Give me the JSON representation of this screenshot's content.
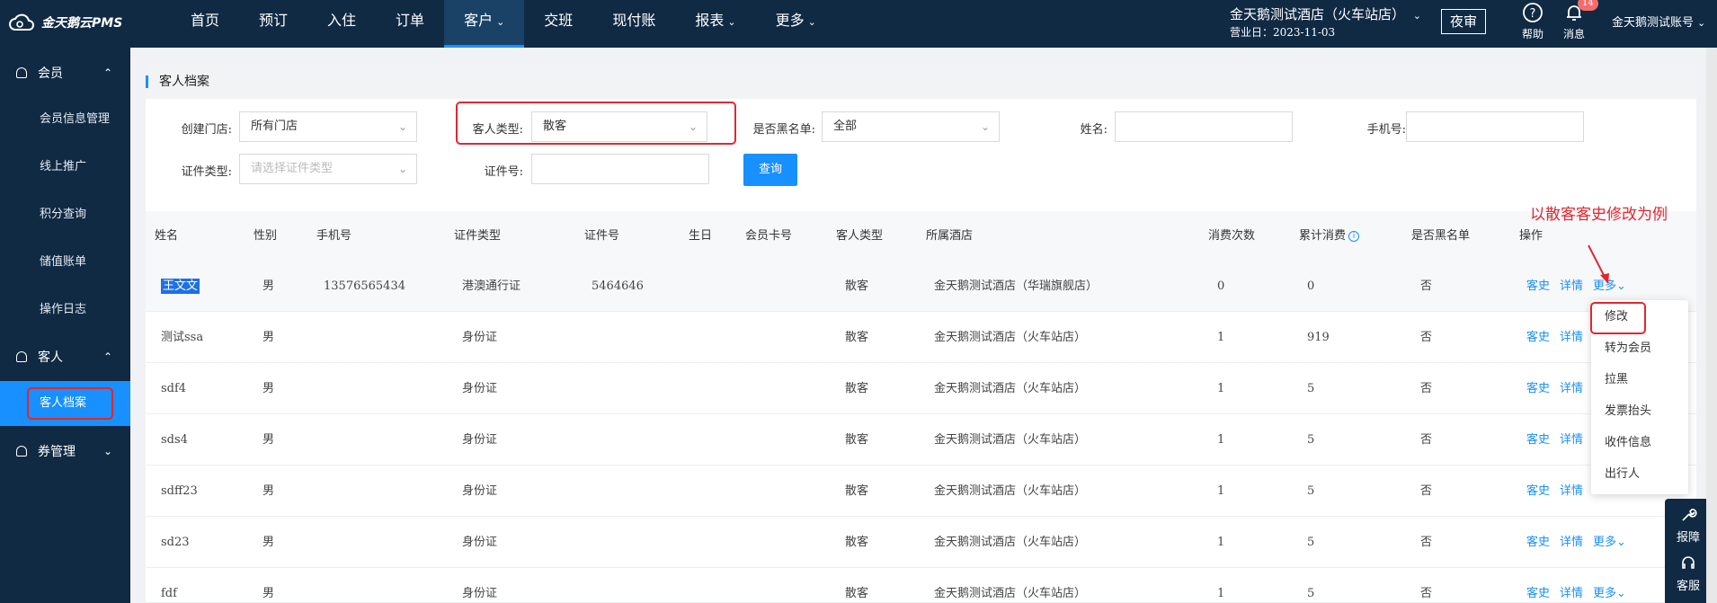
{
  "app": {
    "logo_text": "金天鹅云PMS"
  },
  "nav": [
    {
      "label": "首页"
    },
    {
      "label": "预订"
    },
    {
      "label": "入住"
    },
    {
      "label": "订单"
    },
    {
      "label": "客户"
    },
    {
      "label": "交班"
    },
    {
      "label": "现付账"
    },
    {
      "label": "报表"
    },
    {
      "label": "更多"
    }
  ],
  "topbar": {
    "hotel_name": "金天鹅测试酒店（火车站店）",
    "business_date": "营业日：2023-11-03",
    "night_audit": "夜审",
    "help": "帮助",
    "messages": "消息",
    "message_badge": "14",
    "account": "金天鹅测试账号"
  },
  "sidebar": {
    "groups": [
      {
        "label": "会员",
        "items": [
          "会员信息管理",
          "线上推广",
          "积分查询",
          "储值账单",
          "操作日志"
        ]
      },
      {
        "label": "客人",
        "items": [
          "客人档案"
        ]
      },
      {
        "label": "券管理",
        "items": []
      }
    ]
  },
  "page": {
    "title": "客人档案"
  },
  "filters": {
    "store_label": "创建门店:",
    "store_value": "所有门店",
    "guest_type_label": "客人类型:",
    "guest_type_value": "散客",
    "blacklist_label": "是否黑名单:",
    "blacklist_value": "全部",
    "name_label": "姓名:",
    "phone_label": "手机号:",
    "id_type_label": "证件类型:",
    "id_type_placeholder": "请选择证件类型",
    "id_no_label": "证件号:",
    "query_button": "查询"
  },
  "table": {
    "columns": [
      "姓名",
      "性别",
      "手机号",
      "证件类型",
      "证件号",
      "生日",
      "会员卡号",
      "客人类型",
      "所属酒店",
      "消费次数",
      "累计消费",
      "是否黑名单",
      "操作"
    ],
    "rows": [
      {
        "name": "王文文",
        "gender": "男",
        "phone": "13576565434",
        "id_type": "港澳通行证",
        "id_no": "5464646",
        "birthday": "",
        "card": "",
        "guest_type": "散客",
        "hotel": "金天鹅测试酒店（华瑞旗舰店）",
        "visits": "0",
        "total": "0",
        "blacklist": "否"
      },
      {
        "name": "测试ssa",
        "gender": "男",
        "phone": "",
        "id_type": "身份证",
        "id_no": "",
        "birthday": "",
        "card": "",
        "guest_type": "散客",
        "hotel": "金天鹅测试酒店（火车站店）",
        "visits": "1",
        "total": "919",
        "blacklist": "否"
      },
      {
        "name": "sdf4",
        "gender": "男",
        "phone": "",
        "id_type": "身份证",
        "id_no": "",
        "birthday": "",
        "card": "",
        "guest_type": "散客",
        "hotel": "金天鹅测试酒店（火车站店）",
        "visits": "1",
        "total": "5",
        "blacklist": "否"
      },
      {
        "name": "sds4",
        "gender": "男",
        "phone": "",
        "id_type": "身份证",
        "id_no": "",
        "birthday": "",
        "card": "",
        "guest_type": "散客",
        "hotel": "金天鹅测试酒店（火车站店）",
        "visits": "1",
        "total": "5",
        "blacklist": "否"
      },
      {
        "name": "sdff23",
        "gender": "男",
        "phone": "",
        "id_type": "身份证",
        "id_no": "",
        "birthday": "",
        "card": "",
        "guest_type": "散客",
        "hotel": "金天鹅测试酒店（火车站店）",
        "visits": "1",
        "total": "5",
        "blacklist": "否"
      },
      {
        "name": "sd23",
        "gender": "男",
        "phone": "",
        "id_type": "身份证",
        "id_no": "",
        "birthday": "",
        "card": "",
        "guest_type": "散客",
        "hotel": "金天鹅测试酒店（火车站店）",
        "visits": "1",
        "total": "5",
        "blacklist": "否"
      },
      {
        "name": "fdf",
        "gender": "男",
        "phone": "",
        "id_type": "身份证",
        "id_no": "",
        "birthday": "",
        "card": "",
        "guest_type": "散客",
        "hotel": "金天鹅测试酒店（火车站店）",
        "visits": "1",
        "total": "5",
        "blacklist": "否"
      }
    ],
    "actions": {
      "history": "客史",
      "detail": "详情",
      "more": "更多"
    }
  },
  "more_menu": [
    "修改",
    "转为会员",
    "拉黑",
    "发票抬头",
    "收件信息",
    "出行人"
  ],
  "annotation": "以散客客史修改为例",
  "tools": {
    "report": "报障",
    "service": "客服"
  },
  "colors": {
    "nav_bg": "#102a44",
    "accent": "#1890ff",
    "highlight_box": "#e3262e"
  }
}
